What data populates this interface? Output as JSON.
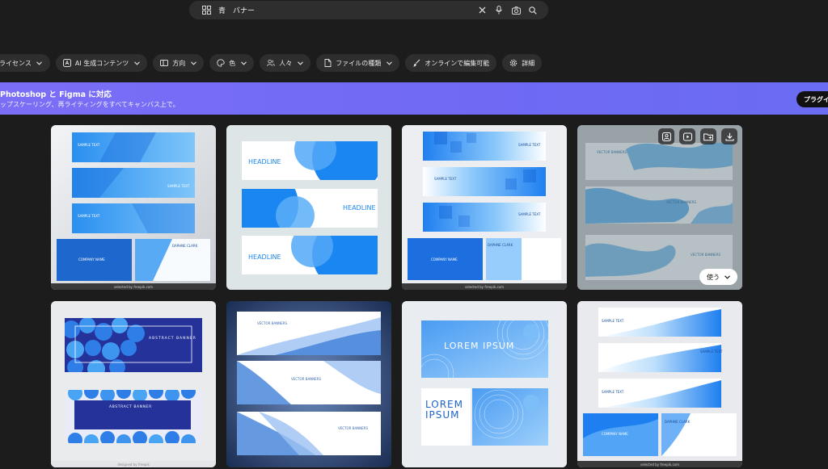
{
  "search": {
    "query_part1": "青",
    "query_part2": "バナー",
    "icons": [
      "grid-icon",
      "close-icon",
      "mic-icon",
      "camera-icon",
      "search-icon"
    ]
  },
  "filters": [
    {
      "label": "ライセンス",
      "icon": "none"
    },
    {
      "label": "AI 生成コンテンツ",
      "icon": "ai-icon"
    },
    {
      "label": "方向",
      "icon": "orientation-icon"
    },
    {
      "label": "色",
      "icon": "palette-icon"
    },
    {
      "label": "人々",
      "icon": "people-icon"
    },
    {
      "label": "ファイルの種類",
      "icon": "file-icon"
    },
    {
      "label": "オンラインで編集可能",
      "icon": "brush-icon"
    },
    {
      "label": "詳細",
      "icon": "gear-icon"
    }
  ],
  "promo": {
    "title": "Photoshop と Figma に対応",
    "subtitle": "ップスケーリング、再ライティングをすべてキャンバス上で。",
    "button": "プラグイ"
  },
  "results": [
    {
      "credit": "selected by freepik.com"
    },
    {
      "credit": ""
    },
    {
      "credit": "selected by freepik.com"
    },
    {
      "credit": "",
      "hover_actions": [
        "image-edit-icon",
        "play-icon",
        "folder-add-icon",
        "download-icon"
      ],
      "use_label": "使う"
    },
    {
      "credit": "designed by freepik"
    },
    {
      "credit": ""
    },
    {
      "credit": ""
    },
    {
      "credit": "selected by freepik.com"
    }
  ],
  "tile_texts": {
    "sample_text": "SAMPLE TEXT",
    "company_name": "COMPANY NAME",
    "daphne_clark": "DAPHNE CLARK",
    "headline": "HEADLINE",
    "vector_banners": "VECTOR BANNERS",
    "abstract_banner": "ABSTRACT BANNER",
    "lorem_ipsum": "LOREM IPSUM",
    "lorem": "LOREM",
    "ipsum": "IPSUM"
  }
}
